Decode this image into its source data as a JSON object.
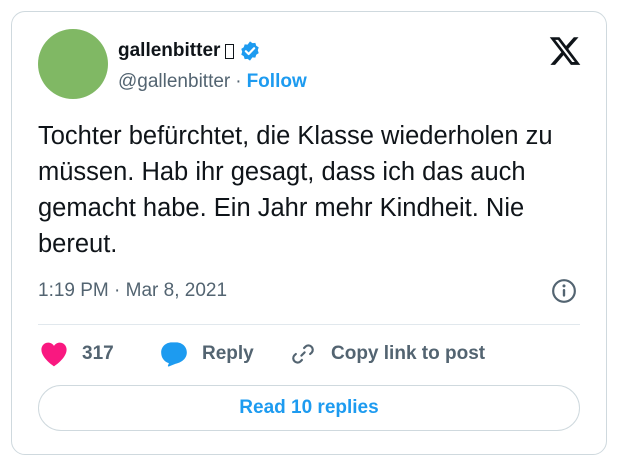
{
  "author": {
    "display_name": "gallenbitter",
    "emoji_glyph": "missing-glyph-box",
    "verified_icon": "verified-badge-icon",
    "handle": "@gallenbitter",
    "separator": "·",
    "follow_label": "Follow"
  },
  "platform_logo": "x-logo-icon",
  "tweet": {
    "text": "Tochter befürchtet, die Klasse wiederholen zu müssen. Hab ihr gesagt, dass ich das auch gemacht habe. Ein Jahr mehr Kindheit. Nie bereut.",
    "timestamp": "1:19 PM · Mar 8, 2021"
  },
  "actions": {
    "like_count": "317",
    "reply_label": "Reply",
    "copy_link_label": "Copy link to post"
  },
  "read_replies_label": "Read 10 replies",
  "colors": {
    "accent": "#1d9bf0",
    "like": "#f91880",
    "avatar": "#80b864",
    "muted_text": "#536471",
    "border": "#cfd9de"
  }
}
